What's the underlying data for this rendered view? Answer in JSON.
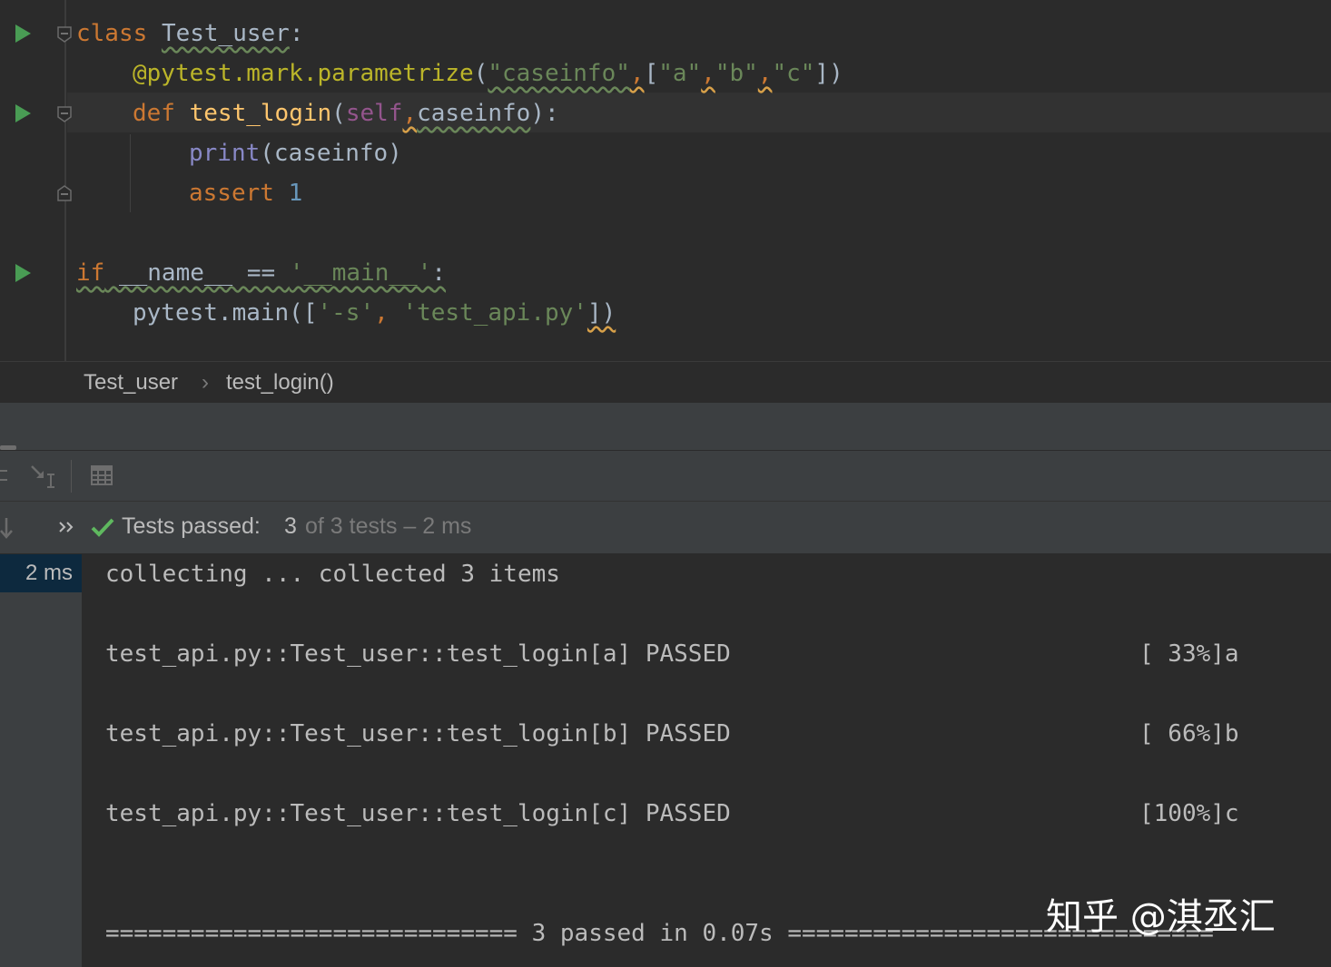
{
  "editor": {
    "lines": {
      "l1": {
        "kw": "class",
        "name": "Test_user",
        "punct": ":"
      },
      "l2": {
        "decorator": "@pytest.mark.parametrize",
        "open": "(",
        "arg": "\"caseinfo\"",
        "comma1": ",",
        "list_open": "[",
        "a": "\"a\"",
        "comma2": ",",
        "b": "\"b\"",
        "comma3": ",",
        "c": "\"c\"",
        "close": "])"
      },
      "l3": {
        "kw": "def",
        "name": "test_login",
        "open": "(",
        "self": "self",
        "comma": ",",
        "param": "caseinfo",
        "close": "):"
      },
      "l4": {
        "builtin": "print",
        "rest": "(caseinfo)"
      },
      "l5": {
        "kw": "assert",
        "num": "1"
      },
      "l6": {
        "kw": "if",
        "rest": " __name__ == ",
        "str": "'__main__'",
        "punct": ":"
      },
      "l7": {
        "pre": "pytest.main([",
        "s": "'-s'",
        "comma": ", ",
        "file": "'test_api.py'",
        "close": "])"
      }
    }
  },
  "breadcrumb": {
    "class": "Test_user",
    "sep": "›",
    "method": "test_login()"
  },
  "status": {
    "label": "Tests passed:",
    "passed": "3",
    "rest": "of 3 tests – 2 ms"
  },
  "console": {
    "time": "2 ms",
    "lines": [
      "collecting ... collected 3 items",
      "test_api.py::Test_user::test_login[a] PASSED",
      "test_api.py::Test_user::test_login[b] PASSED",
      "test_api.py::Test_user::test_login[c] PASSED",
      "============================= 3 passed in 0.07s =============================="
    ],
    "progress": [
      "[ 33%]a",
      "[ 66%]b",
      "[100%]c"
    ]
  },
  "watermark": "知乎 @淇丞汇",
  "colors": {
    "run_green": "#499c54",
    "check_green": "#5fb85f",
    "keyword": "#cc7832",
    "function": "#ffc66d",
    "string": "#6a8759"
  },
  "icons": [
    "run-test-icon",
    "fold-icon",
    "breadcrumb-separator-icon",
    "check-icon",
    "chevron-double-right-icon",
    "arrow-down-icon",
    "table-icon",
    "import-tests-icon"
  ]
}
